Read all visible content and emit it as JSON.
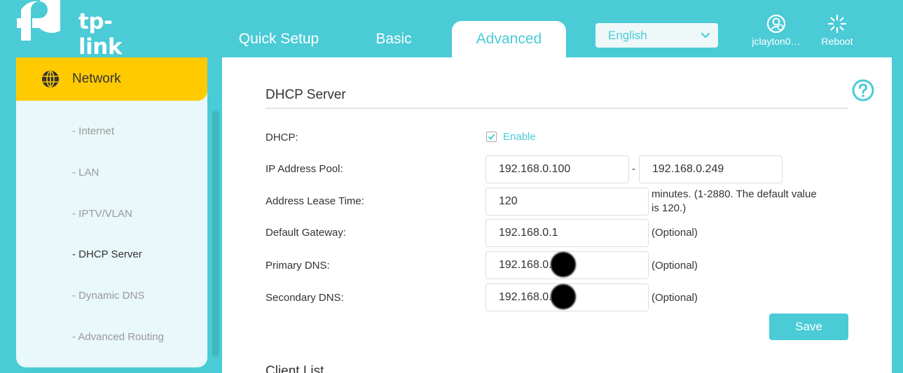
{
  "brand": {
    "name": "tp-link"
  },
  "nav": {
    "tabs": [
      {
        "label": "Quick Setup"
      },
      {
        "label": "Basic"
      },
      {
        "label": "Advanced"
      }
    ]
  },
  "language": {
    "selected": "English"
  },
  "account": {
    "label": "jclayton0…"
  },
  "reboot": {
    "label": "Reboot"
  },
  "sidebar": {
    "section": "Network",
    "items": [
      {
        "label": "- Internet"
      },
      {
        "label": "- LAN"
      },
      {
        "label": "- IPTV/VLAN"
      },
      {
        "label": "- DHCP Server"
      },
      {
        "label": "- Dynamic DNS"
      },
      {
        "label": "- Advanced Routing"
      }
    ]
  },
  "dhcp": {
    "title": "DHCP Server",
    "dhcp_label": "DHCP:",
    "enable_label": "Enable",
    "pool_label": "IP Address Pool:",
    "pool_start": "192.168.0.100",
    "pool_sep": "-",
    "pool_end": "192.168.0.249",
    "lease_label": "Address Lease Time:",
    "lease_value": "120",
    "lease_hint_1": "minutes. (1-2880. The default value",
    "lease_hint_2": "is 120.)",
    "gateway_label": "Default Gateway:",
    "gateway_value": "192.168.0.1",
    "optional": "(Optional)",
    "primary_dns_label": "Primary DNS:",
    "primary_dns_value": "192.168.0.1",
    "secondary_dns_label": "Secondary DNS:",
    "secondary_dns_value": "192.168.0.",
    "save_label": "Save"
  },
  "client_list": {
    "title": "Client List"
  },
  "colors": {
    "accent": "#4acbd6",
    "highlight": "#ffcb00",
    "panel": "#e9f8fa"
  }
}
